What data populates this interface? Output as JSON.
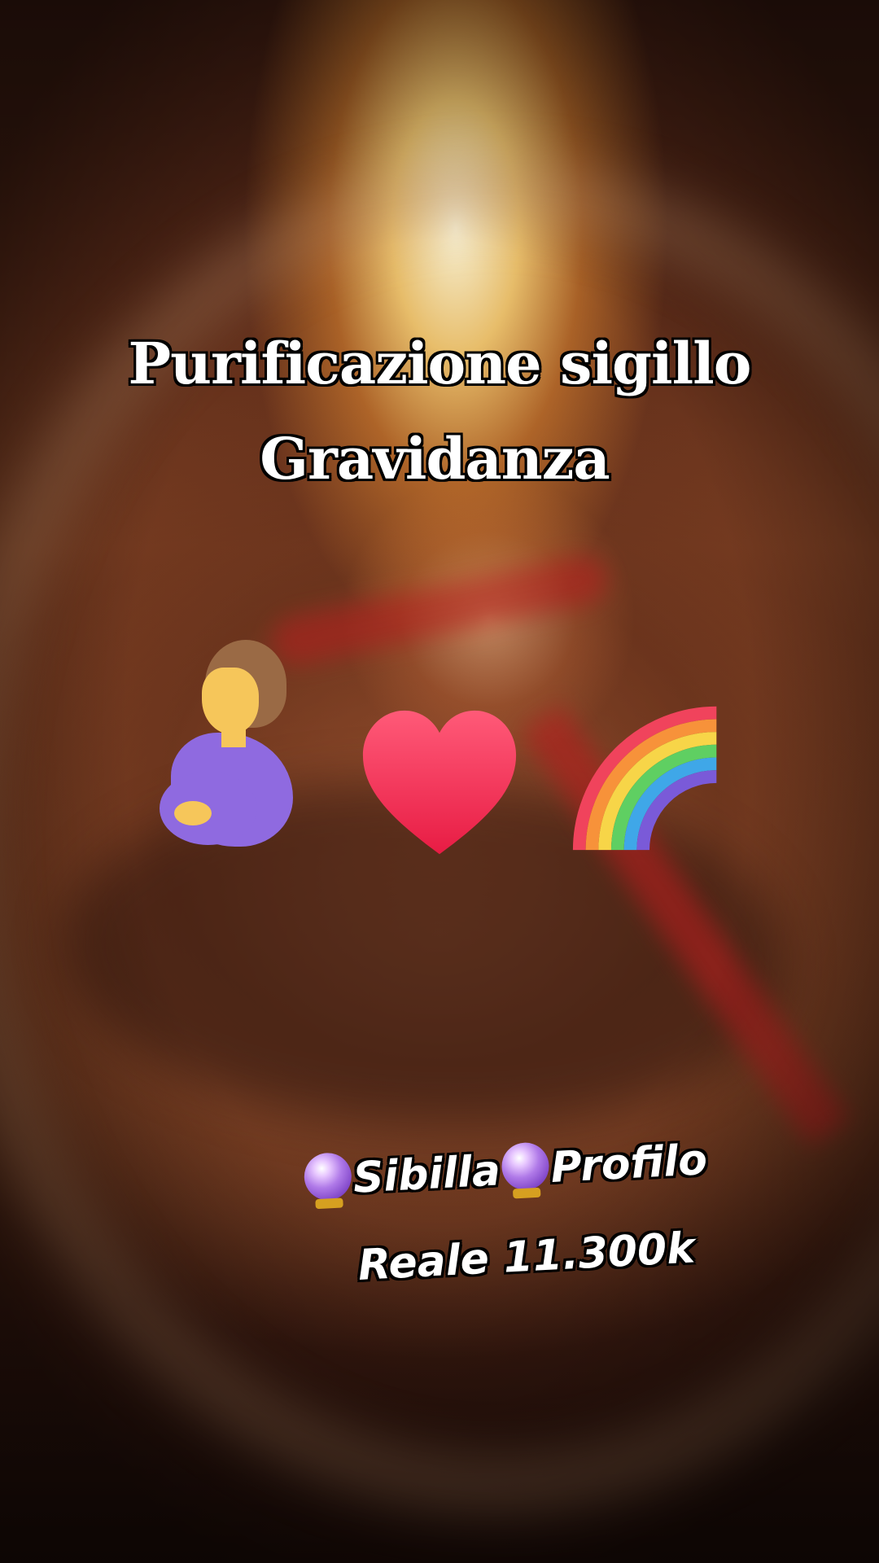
{
  "title": {
    "line1": "Purificazione sigillo",
    "line2": "Gravidanza"
  },
  "emojis": [
    {
      "name": "pregnant-woman-icon"
    },
    {
      "name": "red-heart-icon"
    },
    {
      "name": "rainbow-icon"
    }
  ],
  "credit": {
    "line1_name": "Sibilla",
    "line1_tail": "Profilo",
    "line2": "Reale 11.300k",
    "orb_icon": "crystal-ball-icon"
  },
  "colors": {
    "text": "#ffffff",
    "outline": "#000000",
    "heart": "#f0304e",
    "orb": "#9a5ad8"
  }
}
